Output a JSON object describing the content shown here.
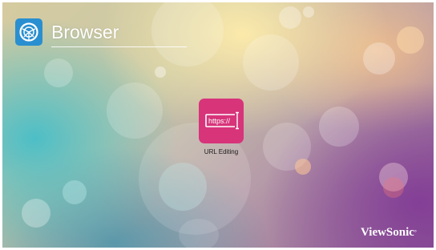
{
  "header": {
    "title": "Browser",
    "icon": "globe-icon",
    "icon_color": "#2a8fd0"
  },
  "apps": [
    {
      "label": "URL Editing",
      "icon": "url-edit-icon",
      "icon_text": "https://",
      "color": "#d7347a"
    }
  ],
  "brand": {
    "logo_text": "ViewSonic"
  }
}
